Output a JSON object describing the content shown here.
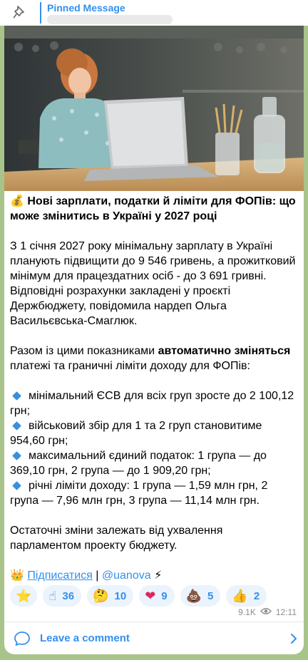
{
  "pinned": {
    "title": "Pinned Message",
    "icon": "pin-icon"
  },
  "post": {
    "headline_emoji": "💰",
    "headline": "Нові зарплати, податки й ліміти для ФОПів: що може змінитись в Україні у 2027 році",
    "para1": "З 1 січня 2027 року мінімальну зарплату в Україні планують підвищити до 9 546 гривень, а прожитковий мінімум для працездатних осіб - до 3 691 гривні. Відповідні розрахунки закладені у проєкті Держбюджету, повідомила нардеп Ольга Васильєвська-Смаглюк.",
    "para2_start": "Разом із цими показниками ",
    "para2_bold": "автоматично зміняться",
    "para2_end": " платежі та граничні ліміти доходу для ФОПів:",
    "bullets": [
      "мінімальний ЄСВ для всіх груп зросте до 2 100,12 грн;",
      "військовий збір для 1 та 2 груп становитиме 954,60 грн;",
      "максимальний єдиний податок: 1 група — до 369,10 грн, 2 група — до 1 909,20 грн;",
      "річні ліміти доходу: 1 група — 1,59 млн грн, 2 група — 7,96 млн грн, 3 група — 11,14 млн грн."
    ],
    "para3": "Остаточні зміни залежать від ухвалення парламентом проекту бюджету.",
    "sign_emoji": "👑",
    "subscribe": "Підписатися",
    "separator": " | ",
    "handle": "@uanova",
    "sign_end_emoji": "⚡"
  },
  "reactions": [
    {
      "emoji": "⭐",
      "count": ""
    },
    {
      "emoji": "☝",
      "count": "36"
    },
    {
      "emoji": "🤔",
      "count": "10"
    },
    {
      "emoji": "❤",
      "count": "9"
    },
    {
      "emoji": "💩",
      "count": "5"
    },
    {
      "emoji": "👍",
      "count": "2"
    }
  ],
  "meta": {
    "views": "9.1K",
    "time": "12:11"
  },
  "comments": {
    "label": "Leave a comment"
  },
  "colors": {
    "accent": "#3390ec",
    "background": "#a9c48a"
  }
}
